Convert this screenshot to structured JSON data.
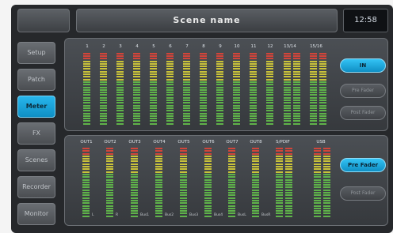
{
  "header": {
    "scene_name": "Scene name",
    "clock": "12:58"
  },
  "nav": [
    "Setup",
    "Patch",
    "Meter",
    "FX",
    "Scenes",
    "Recorder",
    "Monitor"
  ],
  "active_nav": "Meter",
  "inputs": {
    "channels": [
      "1",
      "2",
      "3",
      "4",
      "5",
      "6",
      "7",
      "8",
      "9",
      "10",
      "11",
      "12",
      "13/14",
      "15/16"
    ]
  },
  "outputs": {
    "channels": [
      "OUT1",
      "OUT2",
      "OUT3",
      "OUT4",
      "OUT5",
      "OUT6",
      "OUT7",
      "OUT8",
      "S/PDIF",
      "USB"
    ],
    "sublabels": [
      "L",
      "R",
      "Bus1",
      "Bus2",
      "Bus3",
      "Bus4",
      "BusL",
      "BusR"
    ]
  },
  "input_buttons": [
    "IN",
    "Pre Fader",
    "Post Fader"
  ],
  "input_button_active": "IN",
  "output_buttons": [
    "Pre Fader",
    "Post Fader"
  ],
  "output_button_active": "Pre Fader",
  "meter_colors": {
    "green": "#5fb24a",
    "yellow": "#c9c23a",
    "red": "#d2453a",
    "dim": "#3a3c3f"
  }
}
